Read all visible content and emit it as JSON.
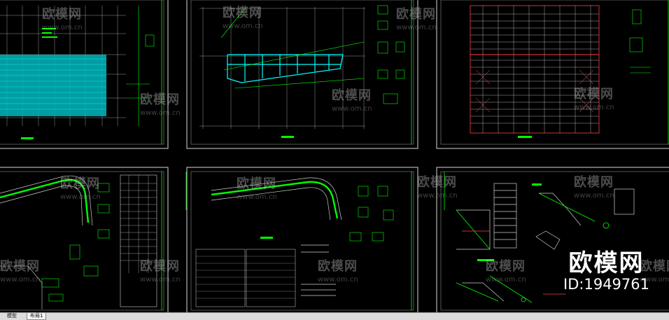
{
  "watermark": {
    "text": "欧模网",
    "url": "www.om.cn"
  },
  "brand": {
    "name": "欧模网",
    "id_label": "ID:1949761"
  },
  "tabs": [
    {
      "label": "模型",
      "active": false
    },
    {
      "label": "布局1",
      "active": true
    }
  ],
  "colors": {
    "background": "#000000",
    "grid_line": "#ffffff",
    "cyan": "#00ffff",
    "green": "#00ff00",
    "red": "#ff3030",
    "yellow": "#ffff00"
  }
}
